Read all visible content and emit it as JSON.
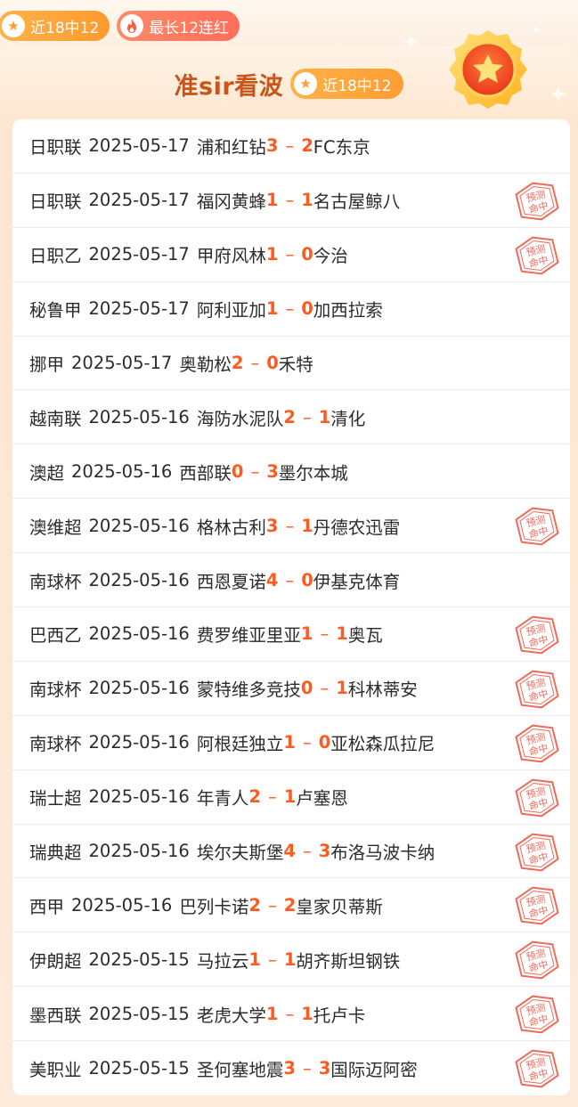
{
  "top_badges": [
    {
      "icon": "star-icon",
      "label": "近18中12"
    },
    {
      "icon": "fire-icon",
      "label": "最长12连红"
    }
  ],
  "header": {
    "title": "准sir看波",
    "badge_icon": "star-icon",
    "badge_label": "近18中12"
  },
  "stamp": {
    "line1": "预测",
    "line2": "命中"
  },
  "colors": {
    "accent": "#ff5a1f",
    "title": "#c9551b",
    "badge": "#ff9d34",
    "stamp": "#f06a5a"
  },
  "matches": [
    {
      "league": "日职联",
      "date": "2025-05-17",
      "home": "浦和红钻",
      "home_score": "3",
      "away_score": "2",
      "away": "FC东京",
      "hit": false
    },
    {
      "league": "日职联",
      "date": "2025-05-17",
      "home": "福冈黄蜂",
      "home_score": "1",
      "away_score": "1",
      "away": "名古屋鲸八",
      "hit": true
    },
    {
      "league": "日职乙",
      "date": "2025-05-17",
      "home": "甲府风林",
      "home_score": "1",
      "away_score": "0",
      "away": "今治",
      "hit": true
    },
    {
      "league": "秘鲁甲",
      "date": "2025-05-17",
      "home": "阿利亚加",
      "home_score": "1",
      "away_score": "0",
      "away": "加西拉索",
      "hit": false
    },
    {
      "league": "挪甲",
      "date": "2025-05-17",
      "home": "奥勒松",
      "home_score": "2",
      "away_score": "0",
      "away": "禾特",
      "hit": false
    },
    {
      "league": "越南联",
      "date": "2025-05-16",
      "home": "海防水泥队",
      "home_score": "2",
      "away_score": "1",
      "away": "清化",
      "hit": false
    },
    {
      "league": "澳超",
      "date": "2025-05-16",
      "home": "西部联",
      "home_score": "0",
      "away_score": "3",
      "away": "墨尔本城",
      "hit": false
    },
    {
      "league": "澳维超",
      "date": "2025-05-16",
      "home": "格林古利",
      "home_score": "3",
      "away_score": "1",
      "away": "丹德农迅雷",
      "hit": true
    },
    {
      "league": "南球杯",
      "date": "2025-05-16",
      "home": "西恩夏诺",
      "home_score": "4",
      "away_score": "0",
      "away": "伊基克体育",
      "hit": false
    },
    {
      "league": "巴西乙",
      "date": "2025-05-16",
      "home": "费罗维亚里亚",
      "home_score": "1",
      "away_score": "1",
      "away": "奥瓦",
      "hit": true
    },
    {
      "league": "南球杯",
      "date": "2025-05-16",
      "home": "蒙特维多竞技",
      "home_score": "0",
      "away_score": "1",
      "away": "科林蒂安",
      "hit": true
    },
    {
      "league": "南球杯",
      "date": "2025-05-16",
      "home": "阿根廷独立",
      "home_score": "1",
      "away_score": "0",
      "away": "亚松森瓜拉尼",
      "hit": true
    },
    {
      "league": "瑞士超",
      "date": "2025-05-16",
      "home": "年青人",
      "home_score": "2",
      "away_score": "1",
      "away": "卢塞恩",
      "hit": true
    },
    {
      "league": "瑞典超",
      "date": "2025-05-16",
      "home": "埃尔夫斯堡",
      "home_score": "4",
      "away_score": "3",
      "away": "布洛马波卡纳",
      "hit": true
    },
    {
      "league": "西甲",
      "date": "2025-05-16",
      "home": "巴列卡诺",
      "home_score": "2",
      "away_score": "2",
      "away": "皇家贝蒂斯",
      "hit": true
    },
    {
      "league": "伊朗超",
      "date": "2025-05-15",
      "home": "马拉云",
      "home_score": "1",
      "away_score": "1",
      "away": "胡齐斯坦钢铁",
      "hit": true
    },
    {
      "league": "墨西联",
      "date": "2025-05-15",
      "home": "老虎大学",
      "home_score": "1",
      "away_score": "1",
      "away": "托卢卡",
      "hit": true
    },
    {
      "league": "美职业",
      "date": "2025-05-15",
      "home": "圣何塞地震",
      "home_score": "3",
      "away_score": "3",
      "away": "国际迈阿密",
      "hit": true
    }
  ]
}
